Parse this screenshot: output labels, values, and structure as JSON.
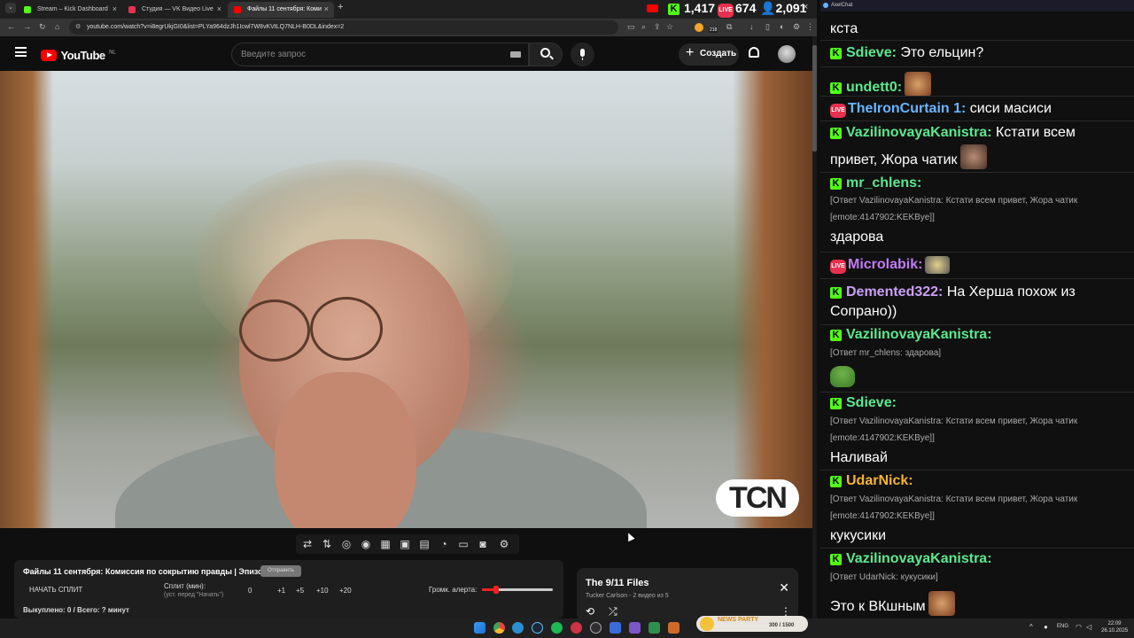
{
  "tabs": [
    {
      "title": "Stream – Kick Dashboard",
      "color": "#53fc18"
    },
    {
      "title": "Студия — VK Видео Live",
      "color": "#e8314f"
    },
    {
      "title": "Файлы 11 сентября: Коми",
      "color": "#ff0000"
    }
  ],
  "stats": {
    "kick_viewers": "1,417",
    "vk_viewers": "674",
    "total_viewers": "2,091",
    "vk_badge": "LIVE"
  },
  "address": {
    "url": "youtube.com/watch?v=i8egrUkjGI0&list=PLYa964dzJh1Icwl7W8vKVtLQ7NLH-B0DL&index=2",
    "ext_badge": "218"
  },
  "youtube": {
    "logo": "YouTube",
    "region": "NL",
    "search_placeholder": "Введите запрос",
    "create_label": "Создать"
  },
  "video": {
    "watermark": "TCN"
  },
  "panel": {
    "title": "Файлы 11 сентября: Комиссия по сокрытию правды | Эпизод 2",
    "tag": "Отправить",
    "start_split": "НАЧАТЬ СПЛИТ",
    "split_label": "Сплит (мин):",
    "split_hint": "(уст. перед \"Начать\")",
    "split_value": "0",
    "inc": [
      "+1",
      "+5",
      "+10",
      "+20"
    ],
    "volume_label": "Громк. алерта:",
    "volume_level": 0.2,
    "status": "Выкуплено: 0 / Всего: ? минут"
  },
  "playlist": {
    "title": "The 9/11 Files",
    "subtitle": "Tucker Carlson - 2 видео из 5"
  },
  "chat": {
    "header": "AxelChat",
    "top_text": "кста",
    "messages": [
      {
        "platform": "kick",
        "name": "Sdieve",
        "color": "#5ce88e",
        "text": "Это ельцин?"
      },
      {
        "platform": "kick",
        "name": "undett0",
        "color": "#5ce88e",
        "text": ""
      },
      {
        "platform": "vk",
        "name": "TheIronCurtain 1",
        "color": "#6ab4ff",
        "text": "сиси масиси"
      },
      {
        "platform": "kick",
        "name": "VazilinovayaKanistra",
        "color": "#5ce88e",
        "text": "Кстати всем",
        "text2": "привет, Жора чатик"
      },
      {
        "platform": "kick",
        "name": "mr_chlens",
        "color": "#5ce88e",
        "reply1": "[Ответ VazilinovayaKanistra: Кстати всем привет, Жора чатик",
        "reply2": "[emote:4147902:KEKBye]]",
        "text": "здарова"
      },
      {
        "platform": "vk",
        "name": "Microlabik",
        "color": "#c07cf5",
        "text": ""
      },
      {
        "platform": "kick",
        "name": "Demented322",
        "color": "#c9a0f5",
        "text": "На Херша похож из",
        "text2": "Сопрано))"
      },
      {
        "platform": "kick",
        "name": "VazilinovayaKanistra",
        "color": "#5ce88e",
        "reply1": "[Ответ mr_chlens: здарова]",
        "text": ""
      },
      {
        "platform": "kick",
        "name": "Sdieve",
        "color": "#5ce88e",
        "reply1": "[Ответ VazilinovayaKanistra: Кстати всем привет, Жора чатик",
        "reply2": "[emote:4147902:KEKBye]]",
        "text": "Наливай"
      },
      {
        "platform": "kick",
        "name": "UdarNick",
        "color": "#f5b431",
        "reply1": "[Ответ VazilinovayaKanistra: Кстати всем привет, Жора чатик",
        "reply2": "[emote:4147902:KEKBye]]",
        "text": "кукусики"
      },
      {
        "platform": "kick",
        "name": "VazilinovayaKanistra",
        "color": "#5ce88e",
        "reply1": "[Ответ UdarNick: кукусики]",
        "text": "Это к ВКшным"
      }
    ]
  },
  "taskbar": {
    "lang": "ENG",
    "time": "22:09",
    "date": "26.10.2025",
    "banner_title": "NEWS PARTY",
    "banner_count": "300 / 1500"
  }
}
